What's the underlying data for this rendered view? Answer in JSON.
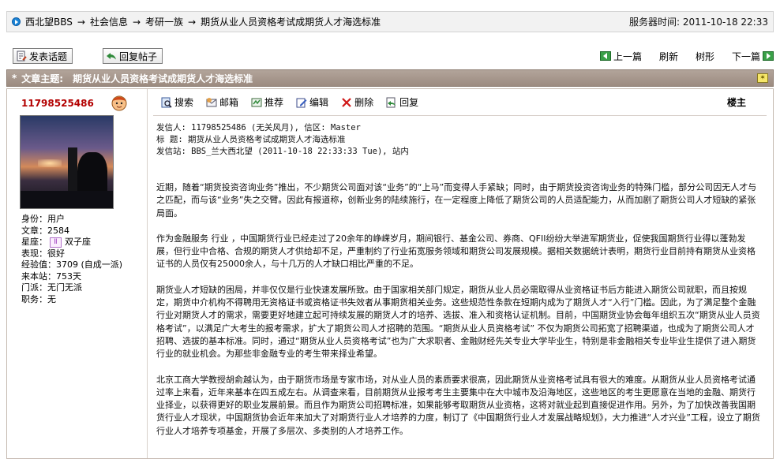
{
  "breadcrumb": {
    "items": [
      "西北望BBS",
      "社会信息",
      "考研一族",
      "期货从业人员资格考试成期货人才海选标准"
    ],
    "separator": "→",
    "server_time": "服务器时间: 2011-10-18 22:33"
  },
  "actions": {
    "new_topic": "发表话题",
    "reply_post": "回复帖子",
    "prev": "上一篇",
    "refresh": "刷新",
    "tree": "树形",
    "next": "下一篇"
  },
  "topic": {
    "star": "*",
    "label": "文章主题:",
    "title": "期货从业人员资格考试成期货人才海选标准"
  },
  "user": {
    "name": "11798525486",
    "info": {
      "identity": "身份：用户",
      "articles": "文章：2584",
      "zodiac_label": "星座：",
      "zodiac_symbol": "Ⅱ",
      "zodiac_name": "双子座",
      "performance": "表现：很好",
      "experience": "经验值：3709 (自成一派)",
      "visits": "来本站：753天",
      "faction": "门派：无门无派",
      "position": "职务：无"
    }
  },
  "post_tools": {
    "search": "搜索",
    "mail": "邮箱",
    "recommend": "推荐",
    "edit": "编辑",
    "delete": "删除",
    "reply": "回复",
    "floor": "楼主"
  },
  "post": {
    "header": {
      "from": "发信人: 11798525486 (无关风月), 信区: Master",
      "subject": "标  题: 期货从业人员资格考试成期货人才海选标准",
      "station": "发信站: BBS_兰大西北望 (2011-10-18 22:33:33 Tue), 站内"
    },
    "paragraphs": [
      "近期，随着“期货投资咨询业务”推出，不少期货公司面对该“业务”的“上马”而变得人手紧缺；同时，由于期货投资咨询业务的特殊门槛，部分公司因无人才与之匹配，而与该“业务”失之交臂。因此有报道称，创新业务的陆续施行，在一定程度上降低了期货公司的人员适配能力，从而加剧了期货公司人才短缺的紧张局面。",
      "作为金融服务 行业 ，中国期货行业已经走过了20余年的峥嵘岁月，期间银行、基金公司、券商、QFII纷纷大举进军期货业，促使我国期货行业得以蓬勃发展，但行业中合格、合规的期货人才供给却不足，严重制约了行业拓宽服务领域和期货公司发展规模。据相关数据统计表明，期货行业目前持有期货从业资格证书的人员仅有25000余人，与十几万的人才缺口相比严重的不足。",
      "期货业人才短缺的困局，并非仅仅是行业快速发展所致。由于国家相关部门规定，期货从业人员必需取得从业资格证书后方能进入期货公司就职，而且按规定，期货中介机构不得聘用无资格证书或资格证书失效者从事期货相关业务。这些规范性条款在短期内成为了期货人才“入行”门槛。因此，为了满足整个金融行业对期货人才的需求，需要更好地建立起可持续发展的期货人才的培养、选拔、准入和资格认证机制。目前，中国期货业协会每年组织五次“期货从业人员资格考试”，以满足广大考生的报考需求，扩大了期货公司人才招聘的范围。“期货从业人员资格考试”  不仅为期货公司拓宽了招聘渠道，也成为了期货公司人才招聘、选拔的基本标准。同时，通过“期货从业人员资格考试”也为广大求职者、金融财经先关专业大学毕业生，特别是非金融相关专业毕业生提供了进入期货行业的就业机会。为那些非金融专业的考生带来择业希望。",
      "北京工商大学教授胡俞越认为，由于期货市场是专家市场，对从业人员的素质要求很高，因此期货从业资格考试具有很大的难度。从期货从业人员资格考试通过率上来看，近年来基本在四五成左右。从调查来看，目前期货从业报考考生主要集中在大中城市及沿海地区，这些地区的考生更愿意在当地的金融、期货行业择业，以获得更好的职业发展前景。而且作为期货公司招聘标准，如果能够考取期货从业资格，这将对就业起到直接促进作用。另外，为了加快改善我国期货行业人才现状，中国期货协会近年来加大了对期货行业人才培养的力度，制订了《中国期货行业人才发展战略规划》，大力推进“人才兴业”工程，设立了期货行业人才培养专项基金，开展了多层次、多类别的人才培养工作。"
    ]
  }
}
